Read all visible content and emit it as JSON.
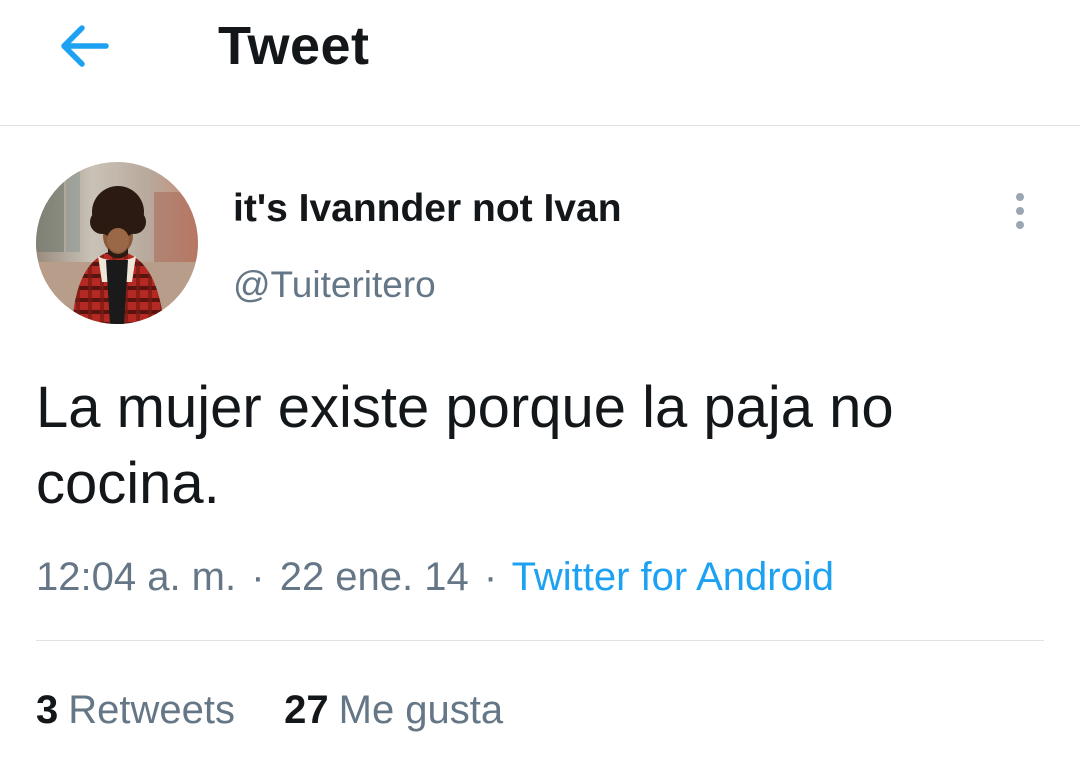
{
  "header": {
    "back_icon": "arrow-left-icon",
    "title": "Tweet",
    "accent_color": "#1da1f2"
  },
  "tweet": {
    "author": {
      "display_name": "it's Ivannder not Ivan",
      "handle": "@Tuiteritero",
      "avatar_icon": "profile-photo"
    },
    "more_icon": "vertical-ellipsis-icon",
    "text": "La mujer existe porque la paja no cocina.",
    "time": "12:04 a. m.",
    "date": "22 ene. 14",
    "separator": "·",
    "source": "Twitter for Android"
  },
  "stats": {
    "retweets_count": "3",
    "retweets_label": "Retweets",
    "likes_count": "27",
    "likes_label": "Me gusta"
  }
}
